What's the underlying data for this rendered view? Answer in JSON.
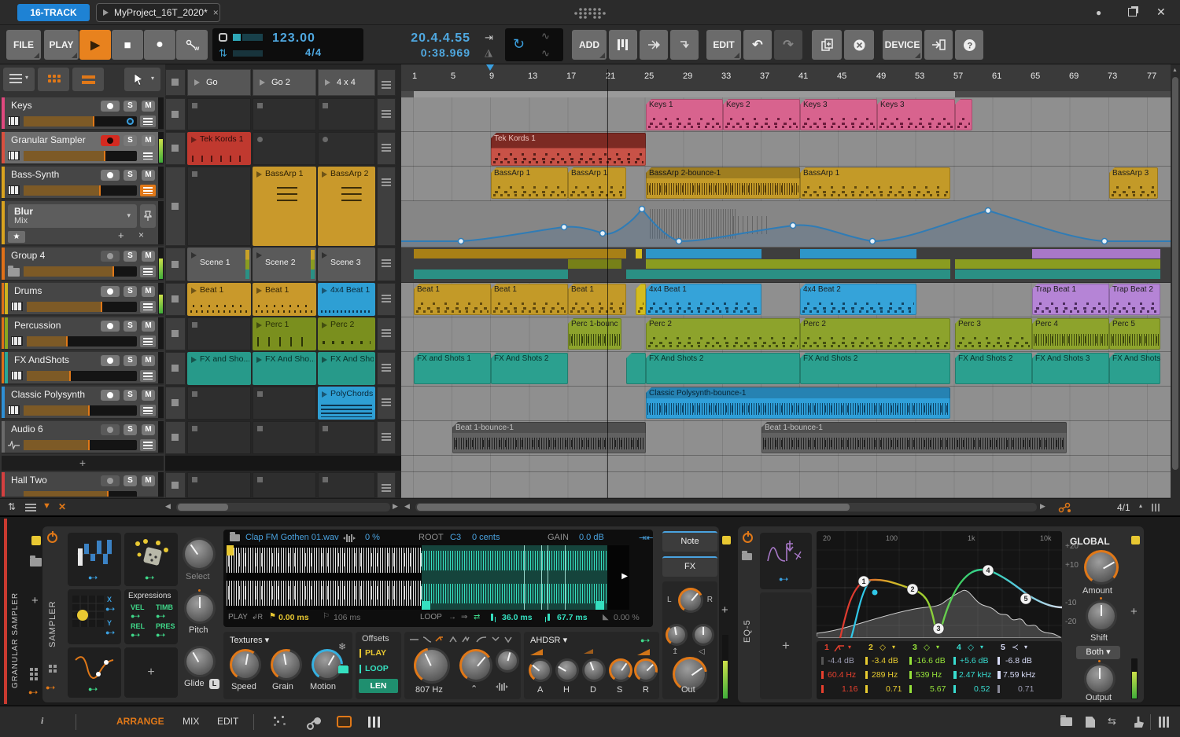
{
  "titlebar": {
    "project": "16-TRACK",
    "tab": "MyProject_16T_2020*",
    "close": "×"
  },
  "transport": {
    "file": "FILE",
    "play": "PLAY",
    "tempo": "123.00",
    "signature": "4/4",
    "position": "20.4.4.55",
    "time": "0:38.969",
    "add": "ADD",
    "edit": "EDIT",
    "device": "DEVICE",
    "help": "?"
  },
  "icons": {
    "play_glyph": "▶",
    "stop_glyph": "■",
    "rec_glyph": "●",
    "undo": "↶",
    "redo": "↷",
    "loop": "↻",
    "left": "◀",
    "right": "▶",
    "up": "▲",
    "plus": "+",
    "close": "✕",
    "star": "★",
    "caret_down": "▾",
    "caret_up": "▴",
    "wave": "∿",
    "punch": "⇥",
    "metro": "◮",
    "swap": "⇅"
  },
  "view_switch": {
    "items": [
      "ARRANGE",
      "MIX",
      "EDIT"
    ],
    "info": "i"
  },
  "zoom_level": "4/1",
  "scenes": [
    "Go",
    "Go 2",
    "4 x 4"
  ],
  "ruler": [
    "1",
    "5",
    "9",
    "13",
    "17",
    "21",
    "25",
    "29",
    "33",
    "37",
    "41",
    "45",
    "49",
    "53",
    "57",
    "61",
    "65",
    "69",
    "73",
    "77"
  ],
  "track_buttons": {
    "solo": "S",
    "mute": "M"
  },
  "add_track": "+",
  "automation_lane": {
    "param": "Blur",
    "target": "Mix"
  },
  "tracks": [
    {
      "name": "Keys",
      "color": "#e0487e"
    },
    {
      "name": "Granular Sampler",
      "color": "#d9503f"
    },
    {
      "name": "Bass-Synth",
      "color": "#d9a31f"
    },
    {
      "name": "Group 4",
      "color": "#e07018"
    },
    {
      "name": "Drums",
      "color": "#cdb31e"
    },
    {
      "name": "Percussion",
      "color": "#8aa81e"
    },
    {
      "name": "FX AndShots",
      "color": "#2aa896"
    },
    {
      "name": "Classic Polysynth",
      "color": "#2e8fd4"
    },
    {
      "name": "Audio 6",
      "color": "#8a8a8a"
    },
    {
      "name": "Hall Two",
      "color": "#d44040"
    }
  ],
  "launcher": {
    "granular": [
      {
        "name": "Tek Kords 1"
      }
    ],
    "bass": [
      {
        "name": "BassArp 1"
      },
      {
        "name": "BassArp 2"
      }
    ],
    "group": [
      {
        "name": "Scene 1"
      },
      {
        "name": "Scene 2"
      },
      {
        "name": "Scene 3"
      }
    ],
    "drums": [
      {
        "name": "Beat 1"
      },
      {
        "name": "Beat 1"
      },
      {
        "name": "4x4 Beat 1"
      }
    ],
    "perc": [
      {
        "name": "Perc 1"
      },
      {
        "name": "Perc 2"
      }
    ],
    "fx": [
      {
        "name": "FX and Sho..."
      },
      {
        "name": "FX And Sho..."
      },
      {
        "name": "FX And Sho"
      }
    ],
    "poly": [
      {
        "name": "PolyChords"
      }
    ]
  },
  "arranger": {
    "keys": [
      {
        "name": "Keys 1",
        "start": 25,
        "end": 33
      },
      {
        "name": "Keys 2",
        "start": 33,
        "end": 41
      },
      {
        "name": "Keys 3",
        "start": 41,
        "end": 49
      },
      {
        "name": "Keys 3",
        "start": 49,
        "end": 57
      }
    ],
    "granular": [
      {
        "name": "Tek Kords 1",
        "start": 9,
        "end": 25
      }
    ],
    "bass": [
      {
        "name": "BassArp 1",
        "start": 9,
        "end": 17
      },
      {
        "name": "BassArp 1",
        "start": 17,
        "end": 23
      },
      {
        "name": "BassArp 2-bounce-1",
        "start": 25,
        "end": 41
      },
      {
        "name": "BassArp 1",
        "start": 41,
        "end": 56.5
      },
      {
        "name": "BassArp 3",
        "start": 73,
        "end": 78
      }
    ],
    "drums": [
      {
        "name": "Beat 1",
        "start": 1,
        "end": 9
      },
      {
        "name": "Beat 1",
        "start": 9,
        "end": 17
      },
      {
        "name": "Beat 1",
        "start": 17,
        "end": 23
      },
      {
        "name": "4x4 Beat 1",
        "start": 25,
        "end": 37
      },
      {
        "name": "4x4 Beat 2",
        "start": 41,
        "end": 53
      },
      {
        "name": "Trap Beat 1",
        "start": 65,
        "end": 73
      },
      {
        "name": "Trap Beat 2",
        "start": 73,
        "end": 78
      }
    ],
    "perc": [
      {
        "name": "Perc 1-bounc",
        "start": 17,
        "end": 22.5
      },
      {
        "name": "Perc 2",
        "start": 25,
        "end": 41
      },
      {
        "name": "Perc 2",
        "start": 41,
        "end": 56.5
      },
      {
        "name": "Perc 3",
        "start": 57,
        "end": 65
      },
      {
        "name": "Perc 4",
        "start": 65,
        "end": 73
      },
      {
        "name": "Perc 5",
        "start": 73,
        "end": 78
      }
    ],
    "fx": [
      {
        "name": "FX and Shots 1",
        "start": 1,
        "end": 9
      },
      {
        "name": "FX And Shots 2",
        "start": 9,
        "end": 17
      },
      {
        "name": "FX And Shots 2",
        "start": 25,
        "end": 41
      },
      {
        "name": "FX And Shots 2",
        "start": 41,
        "end": 56.5
      },
      {
        "name": "FX And Shots 2",
        "start": 57,
        "end": 65
      },
      {
        "name": "FX And Shots 3",
        "start": 65,
        "end": 73
      },
      {
        "name": "FX And Shots",
        "start": 73,
        "end": 78
      }
    ],
    "poly": [
      {
        "name": "Classic Polysynth-bounce-1",
        "start": 25,
        "end": 56.5
      }
    ],
    "audio": [
      {
        "name": "Beat 1-bounce-1",
        "start": 5,
        "end": 25
      },
      {
        "name": "Beat 1-bounce-1",
        "start": 37,
        "end": 68.5
      }
    ]
  },
  "sampler": {
    "track_label": "GRANULAR SAMPLER",
    "device_label": "SAMPLER",
    "file": "Clap FM Gothen 01.wav",
    "velocity": "0 %",
    "root_label": "ROOT",
    "root_note": "C3",
    "tune": "0 cents",
    "gain_label": "GAIN",
    "gain": "0.0 dB",
    "play_label": "PLAY",
    "start": "0.00 ms",
    "length": "106 ms",
    "loop_label": "LOOP",
    "loop_start": "36.0 ms",
    "loop_length": "67.7 ms",
    "crossfade": "0.00 %",
    "expressions": {
      "title": "Expressions",
      "items": [
        "VEL",
        "TIMB",
        "REL",
        "PRES"
      ]
    },
    "xy": {
      "x": "X",
      "y": "Y"
    },
    "knobs": {
      "select": "Select",
      "pitch": "Pitch",
      "glide": "Glide",
      "glide_badge": "L"
    },
    "textures": {
      "title": "Textures",
      "speed": "Speed",
      "grain": "Grain",
      "motion": "Motion"
    },
    "offsets": {
      "title": "Offsets",
      "play": "PLAY",
      "loop": "LOOP",
      "len": "LEN"
    },
    "filter": {
      "cutoff": "807 Hz"
    },
    "envelope": {
      "title": "AHDSR",
      "knobs": [
        "A",
        "H",
        "D",
        "S",
        "R"
      ]
    },
    "chains": {
      "note": "Note",
      "fx": "FX"
    },
    "pan": {
      "l": "L",
      "r": "R"
    },
    "out": "Out"
  },
  "eq": {
    "device_label": "EQ-5",
    "freq_ticks": [
      "20",
      "100",
      "1k",
      "10k"
    ],
    "db_ticks": [
      "+20",
      "+10",
      "-10",
      "-20"
    ],
    "bands": [
      {
        "num": "1",
        "gain": "-4.4 dB",
        "freq": "60.4 Hz",
        "q": "1.16",
        "color": "#e8402e"
      },
      {
        "num": "2",
        "gain": "-3.4 dB",
        "freq": "289 Hz",
        "q": "0.71",
        "color": "#e8cc30"
      },
      {
        "num": "3",
        "gain": "-16.6 dB",
        "freq": "539 Hz",
        "q": "5.67",
        "color": "#96e23a"
      },
      {
        "num": "4",
        "gain": "+5.6 dB",
        "freq": "2.47 kHz",
        "q": "0.52",
        "color": "#38dcd0"
      },
      {
        "num": "5",
        "gain": "-6.8 dB",
        "freq": "7.59 kHz",
        "q": "0.71",
        "color": "#d8dcf8"
      }
    ],
    "global": {
      "title": "GLOBAL",
      "amount": "Amount",
      "shift": "Shift",
      "mode": "Both",
      "output": "Output"
    }
  }
}
